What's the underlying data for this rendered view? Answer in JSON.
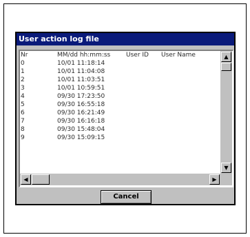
{
  "dialog": {
    "title": "User action log file",
    "columns": [
      "Nr",
      "MM/dd hh:mm:ss",
      "User ID",
      "User Name"
    ],
    "rows": [
      {
        "nr": "0",
        "time": "10/01 11:18:14"
      },
      {
        "nr": "1",
        "time": "10/01 11:04:08"
      },
      {
        "nr": "2",
        "time": "10/01 11:03:51"
      },
      {
        "nr": "3",
        "time": "10/01 10:59:51"
      },
      {
        "nr": "4",
        "time": "09/30 17:23:50"
      },
      {
        "nr": "5",
        "time": "09/30 16:55:18"
      },
      {
        "nr": "6",
        "time": "09/30 16:21:49"
      },
      {
        "nr": "7",
        "time": "09/30 16:16:18"
      },
      {
        "nr": "8",
        "time": "09/30 15:48:04"
      },
      {
        "nr": "9",
        "time": "09/30 15:09:15"
      }
    ],
    "cancel_label": "Cancel"
  },
  "icons": {
    "scroll_up": "arrow-up-icon",
    "scroll_down": "arrow-down-icon",
    "scroll_left": "arrow-left-icon",
    "scroll_right": "arrow-right-icon"
  },
  "colors": {
    "titlebar": "#0a1a7a",
    "dialog_bg": "#c0c0c0"
  }
}
